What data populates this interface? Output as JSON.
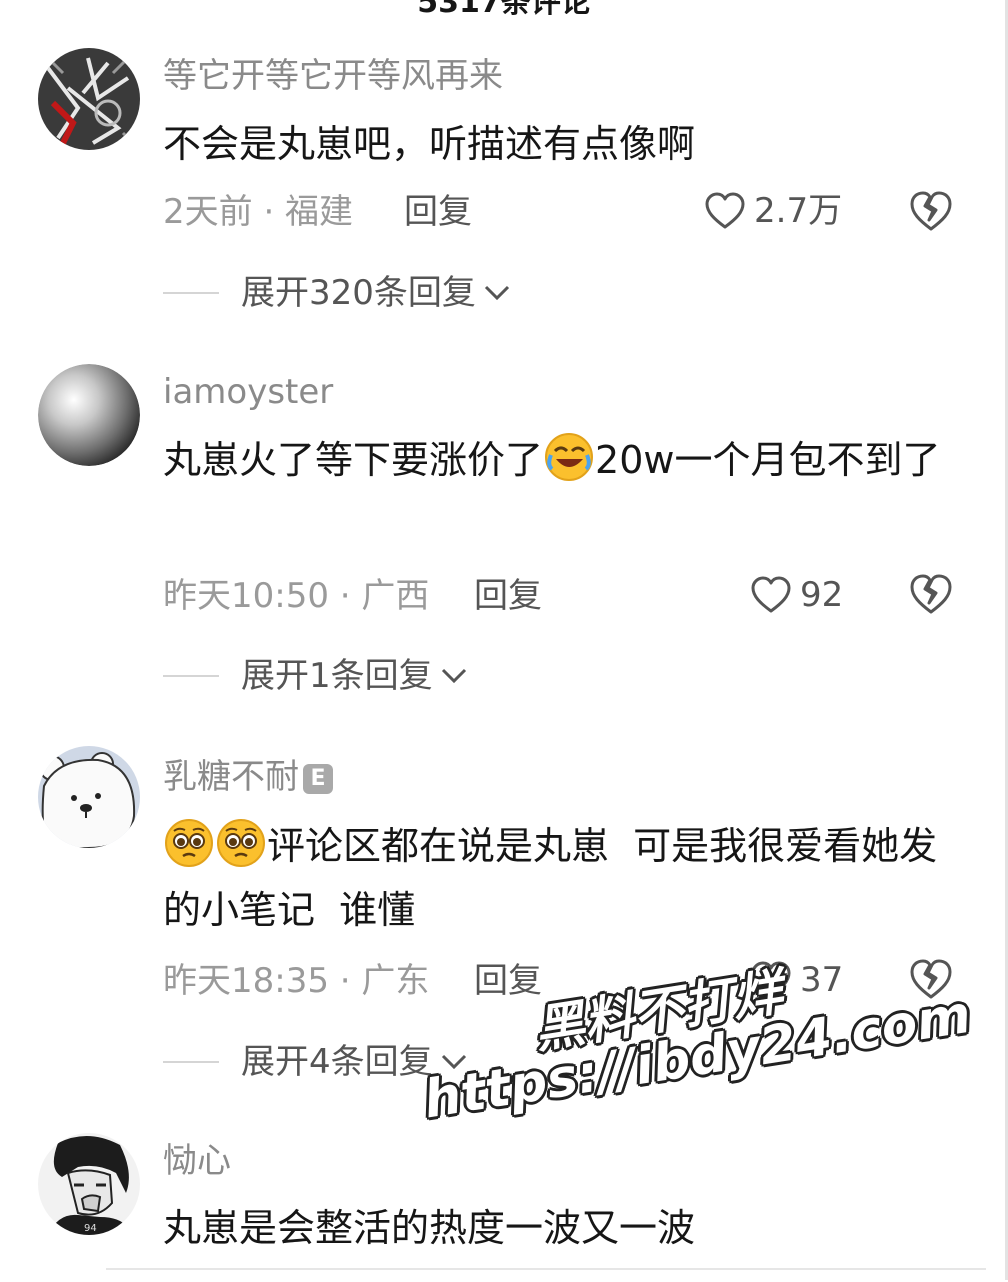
{
  "header": {
    "title": "5317条评论"
  },
  "comments": [
    {
      "username": "等它开等它开等风再来",
      "badge": "",
      "text": "不会是丸崽吧，听描述有点像啊",
      "text_after_emoji": "",
      "text_before_emoji": "",
      "meta": "2天前 · 福建",
      "reply": "回复",
      "likes": "2.7万",
      "expand": "展开320条回复"
    },
    {
      "username": "iamoyster",
      "badge": "",
      "text_before_emoji": "丸崽火了等下要涨价了",
      "text_after_emoji": "20w一个月包不到了",
      "meta": "昨天10:50 · 广西",
      "reply": "回复",
      "likes": "92",
      "expand": "展开1条回复"
    },
    {
      "username": "乳糖不耐",
      "badge": "E",
      "text_after_emoji": "评论区都在说是丸崽  可是我很爱看她发的小笔记  谁懂",
      "meta": "昨天18:35 · 广东",
      "reply": "回复",
      "likes": "37",
      "expand": "展开4条回复"
    },
    {
      "username": "恸心",
      "badge": "",
      "text": "丸崽是会整活的热度一波又一波"
    }
  ],
  "watermark": {
    "line1": "黑料不打烊",
    "line2": "https://ibdy24.com"
  },
  "icons": {
    "heart": "heart-outline-icon",
    "dislike": "broken-heart-icon",
    "chevron": "chevron-down-icon"
  },
  "colors": {
    "text": "#161616",
    "muted": "#9a9a9a",
    "secondary": "#555555"
  }
}
